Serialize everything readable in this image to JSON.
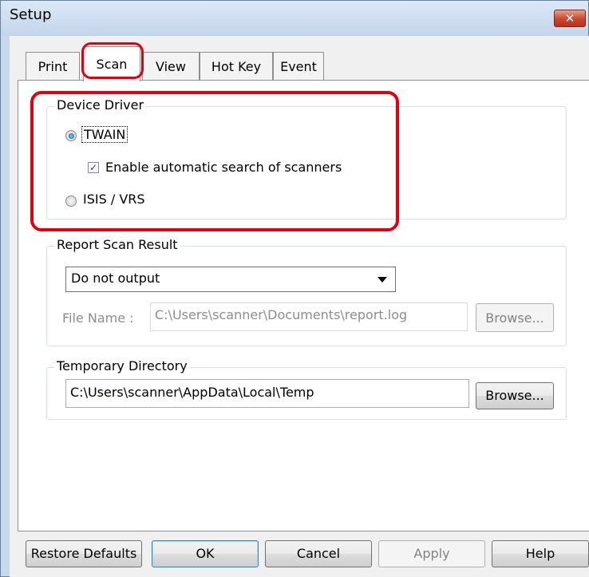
{
  "window": {
    "title": "Setup",
    "close_glyph": "✕"
  },
  "tabs": [
    "Print",
    "Scan",
    "View",
    "Hot Key",
    "Event"
  ],
  "device_driver": {
    "legend": "Device Driver",
    "twain_label": "TWAIN",
    "auto_search_label": "Enable automatic search of scanners",
    "isis_label": "ISIS / VRS"
  },
  "report": {
    "legend": "Report Scan Result",
    "selected": "Do not output",
    "file_label": "File Name :",
    "file_value": "C:\\Users\\scanner\\Documents\\report.log",
    "browse_label": "Browse..."
  },
  "temp": {
    "legend": "Temporary Directory",
    "value": "C:\\Users\\scanner\\AppData\\Local\\Temp",
    "browse_label": "Browse..."
  },
  "footer": {
    "restore": "Restore Defaults",
    "ok": "OK",
    "cancel": "Cancel",
    "apply": "Apply",
    "help": "Help"
  },
  "colors": {
    "highlight": "#e00010",
    "titlebar": "#c9d9ec"
  }
}
